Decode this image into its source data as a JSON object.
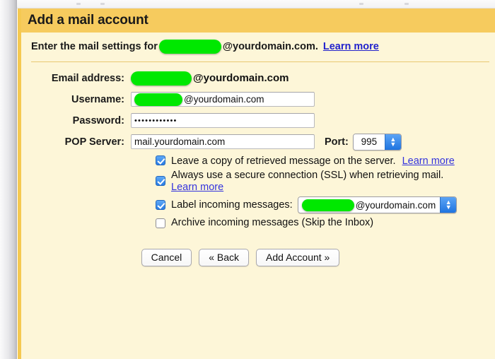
{
  "window": {
    "panel_title": "Add a mail account"
  },
  "subtitle": {
    "prefix": "Enter the mail settings for",
    "redacted_user": "",
    "domain_suffix": "@yourdomain.com.",
    "learn_more": "Learn more"
  },
  "form": {
    "email": {
      "label": "Email address:",
      "redacted_user": "",
      "domain_suffix": "@yourdomain.com"
    },
    "username": {
      "label": "Username:",
      "redacted_user": "",
      "value_suffix": "@yourdomain.com"
    },
    "password": {
      "label": "Password:",
      "value": "••••••••••••"
    },
    "pop_server": {
      "label": "POP Server:",
      "value": "mail.yourdomain.com"
    },
    "port": {
      "label": "Port:",
      "value": "995"
    }
  },
  "options": {
    "leave_copy": {
      "label": "Leave a copy of retrieved message on the server.",
      "learn_more": "Learn more",
      "checked": true
    },
    "ssl": {
      "label": "Always use a secure connection (SSL) when retrieving mail.",
      "learn_more": "Learn more",
      "checked": true
    },
    "label_incoming": {
      "label": "Label incoming messages:",
      "redacted_user": "",
      "value_suffix": "@yourdomain.com",
      "checked": true
    },
    "archive": {
      "label": "Archive incoming messages (Skip the Inbox)",
      "checked": false
    }
  },
  "buttons": {
    "cancel": "Cancel",
    "back": "« Back",
    "add_account": "Add Account »"
  },
  "colors": {
    "header_yellow": "#f6cb5e",
    "body_cream": "#fdf6d8",
    "border_yellow": "#f5c951",
    "link_blue": "#2222cc",
    "redaction_green": "#00e800",
    "control_blue": "#2a7de3"
  }
}
